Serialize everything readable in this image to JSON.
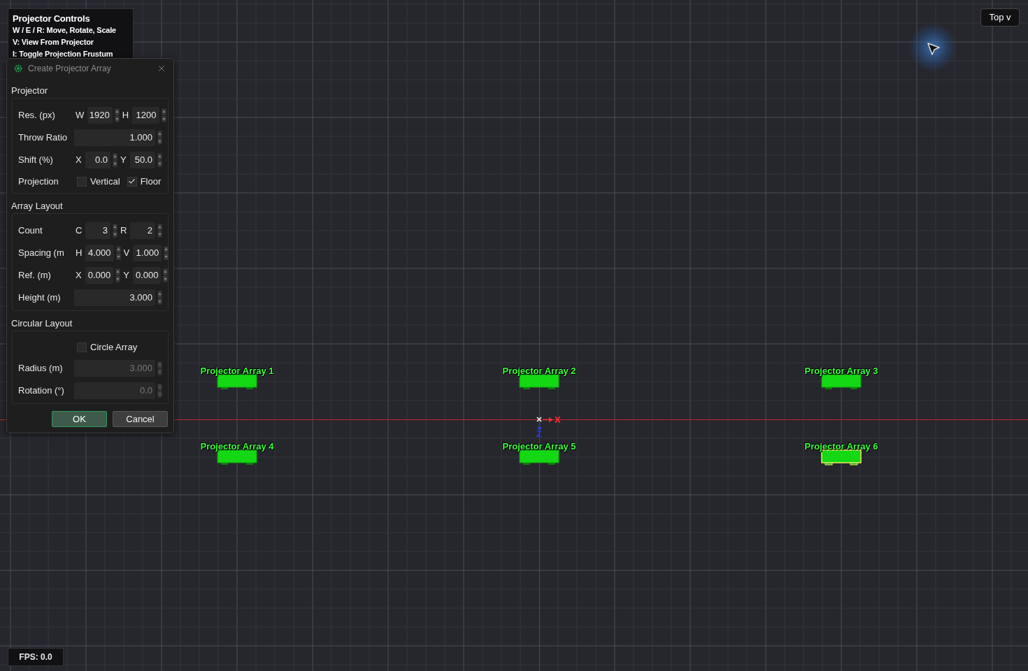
{
  "overlay": {
    "title": "Projector Controls",
    "lines": [
      "W / E / R: Move, Rotate, Scale",
      "V: View From Projector",
      "I: Toggle Projection Frustum"
    ]
  },
  "view_button": "Top v",
  "fps": "FPS: 0.0",
  "axes": [
    {
      "label": "X"
    },
    {
      "label": "Z"
    }
  ],
  "projectors": [
    {
      "label": "Projector Array 1",
      "selected": false
    },
    {
      "label": "Projector Array 2",
      "selected": false
    },
    {
      "label": "Projector Array 3",
      "selected": false
    },
    {
      "label": "Projector Array 4",
      "selected": false
    },
    {
      "label": "Projector Array 5",
      "selected": false
    },
    {
      "label": "Projector Array 6",
      "selected": true
    }
  ],
  "dialog": {
    "title": "Create Projector Array",
    "sections": [
      {
        "title": "Projector",
        "rows": [
          {
            "kind": "fields",
            "label": "Res. (px)",
            "fields": [
              {
                "prefix": "W",
                "value": "1920",
                "disabled": false
              },
              {
                "prefix": "H",
                "value": "1200",
                "disabled": false
              }
            ]
          },
          {
            "kind": "fields",
            "label": "Throw Ratio",
            "fields": [
              {
                "value": "1.000",
                "disabled": false
              }
            ]
          },
          {
            "kind": "fields",
            "label": "Shift (%)",
            "fields": [
              {
                "prefix": "X",
                "value": "0.0",
                "disabled": false
              },
              {
                "prefix": "Y",
                "value": "50.0",
                "disabled": false
              }
            ]
          },
          {
            "kind": "checks",
            "label": "Projection",
            "checks": [
              {
                "label": "Vertical",
                "checked": false
              },
              {
                "label": "Floor",
                "checked": true
              }
            ]
          }
        ]
      },
      {
        "title": "Array Layout",
        "rows": [
          {
            "kind": "fields",
            "label": "Count",
            "fields": [
              {
                "prefix": "C",
                "value": "3",
                "disabled": false
              },
              {
                "prefix": "R",
                "value": "2",
                "disabled": false
              }
            ]
          },
          {
            "kind": "fields",
            "label": "Spacing (m",
            "fields": [
              {
                "prefix": "H",
                "value": "4.000",
                "disabled": false
              },
              {
                "prefix": "V",
                "value": "1.000",
                "disabled": false
              }
            ]
          },
          {
            "kind": "fields",
            "label": "Ref. (m)",
            "fields": [
              {
                "prefix": "X",
                "value": "0.000",
                "disabled": false
              },
              {
                "prefix": "Y",
                "value": "0.000",
                "disabled": false
              }
            ]
          },
          {
            "kind": "fields",
            "label": "Height (m)",
            "fields": [
              {
                "value": "3.000",
                "disabled": false
              }
            ]
          }
        ]
      },
      {
        "title": "Circular Layout",
        "rows": [
          {
            "kind": "checks",
            "checks": [
              {
                "label": "Circle Array",
                "checked": false
              }
            ]
          },
          {
            "kind": "fields",
            "label": "Radius (m)",
            "fields": [
              {
                "value": "3.000",
                "disabled": true
              }
            ]
          },
          {
            "kind": "fields",
            "label": "Rotation (°)",
            "fields": [
              {
                "value": "0.0",
                "disabled": true
              }
            ]
          }
        ]
      }
    ],
    "buttons": [
      {
        "label": "OK",
        "default": true
      },
      {
        "label": "Cancel",
        "default": false
      }
    ]
  }
}
